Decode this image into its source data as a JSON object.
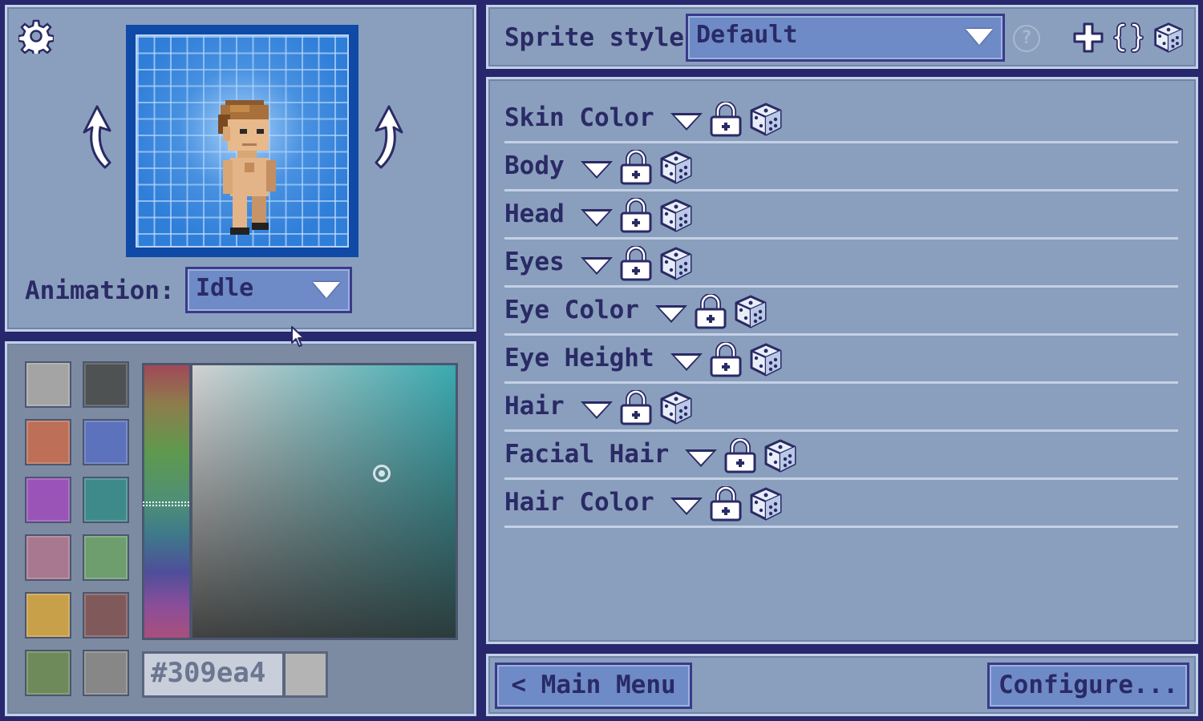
{
  "preview": {
    "settings_icon": "gear-icon",
    "rotate_left_icon": "rotate-left-arrow-icon",
    "rotate_right_icon": "rotate-right-arrow-icon",
    "animation_label": "Animation:",
    "animation_value": "Idle"
  },
  "color_picker": {
    "swatches": [
      "#a4a4a4",
      "#4f5252",
      "#bd6f58",
      "#5c72bc",
      "#9a54b8",
      "#3e8a8a",
      "#a87890",
      "#6e9e6e",
      "#c8a04a",
      "#805a5a",
      "#6e8a5a",
      "#878787"
    ],
    "hex_value": "#309ea4",
    "preview_color": "#b4b4b4"
  },
  "header": {
    "sprite_style_label": "Sprite style:",
    "sprite_style_value": "Default",
    "help_label": "?",
    "icons": [
      "plus-icon",
      "braces-icon",
      "dice-icon"
    ]
  },
  "layers": [
    {
      "label": "Skin Color"
    },
    {
      "label": "Body"
    },
    {
      "label": "Head"
    },
    {
      "label": "Eyes"
    },
    {
      "label": "Eye Color"
    },
    {
      "label": "Eye Height"
    },
    {
      "label": "Hair"
    },
    {
      "label": "Facial Hair"
    },
    {
      "label": "Hair Color"
    }
  ],
  "footer": {
    "main_menu_label": "< Main Menu",
    "configure_label": "Configure... >"
  }
}
